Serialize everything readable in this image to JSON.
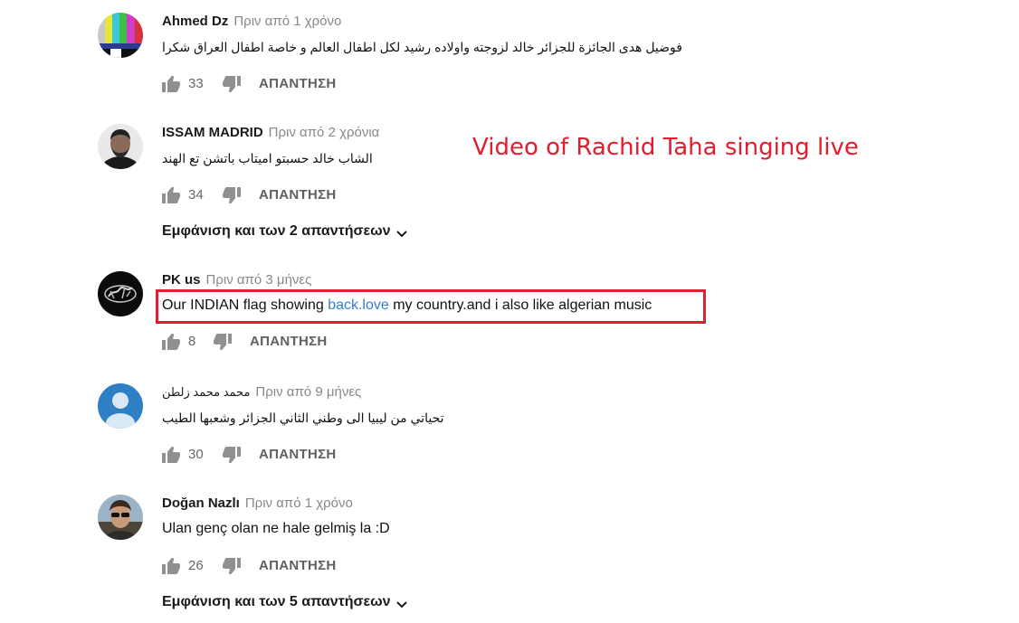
{
  "annotation": "Video of Rachid Taha singing live",
  "icons": {
    "like": "thumbs-up-icon",
    "dislike": "thumbs-down-icon",
    "chevron": "chevron-down-icon"
  },
  "colors": {
    "annotation": "#e11d2e",
    "link": "#2f7ed8",
    "muted": "#888888"
  },
  "comments": [
    {
      "author": "Ahmed Dz",
      "time": "Πριν από 1 χρόνο",
      "text": "فوضيل هدى الجائزة للجزائر خالد لزوجته واولاده رشيد لكل اطفال العالم و خاصة اطفال العراق شكرا",
      "likes": "33",
      "reply": "ΑΠΑΝΤΗΣΗ"
    },
    {
      "author": "ISSAM MADRID",
      "time": "Πριν από 2 χρόνια",
      "text": "الشاب خالد حسبتو اميتاب باتشن تع الهند",
      "likes": "34",
      "reply": "ΑΠΑΝΤΗΣΗ",
      "view_replies": "Εμφάνιση και των 2 απαντήσεων"
    },
    {
      "author": "PK us",
      "time": "Πριν από 3 μήνες",
      "text_before": "Our INDIAN flag showing ",
      "text_link": "back.love",
      "text_after": " my country.and i also like algerian music",
      "likes": "8",
      "reply": "ΑΠΑΝΤΗΣΗ"
    },
    {
      "author": "محمد محمد زلطن",
      "time": "Πριν από 9 μήνες",
      "text": "تحياتي من ليبيا الى وطني الثاني الجزائر وشعبها الطيب",
      "likes": "30",
      "reply": "ΑΠΑΝΤΗΣΗ"
    },
    {
      "author": "Doğan Nazlı",
      "time": "Πριν από 1 χρόνο",
      "text": "Ulan genç olan ne hale gelmiş la :D",
      "likes": "26",
      "reply": "ΑΠΑΝΤΗΣΗ",
      "view_replies": "Εμφάνιση και των 5 απαντήσεων"
    }
  ]
}
